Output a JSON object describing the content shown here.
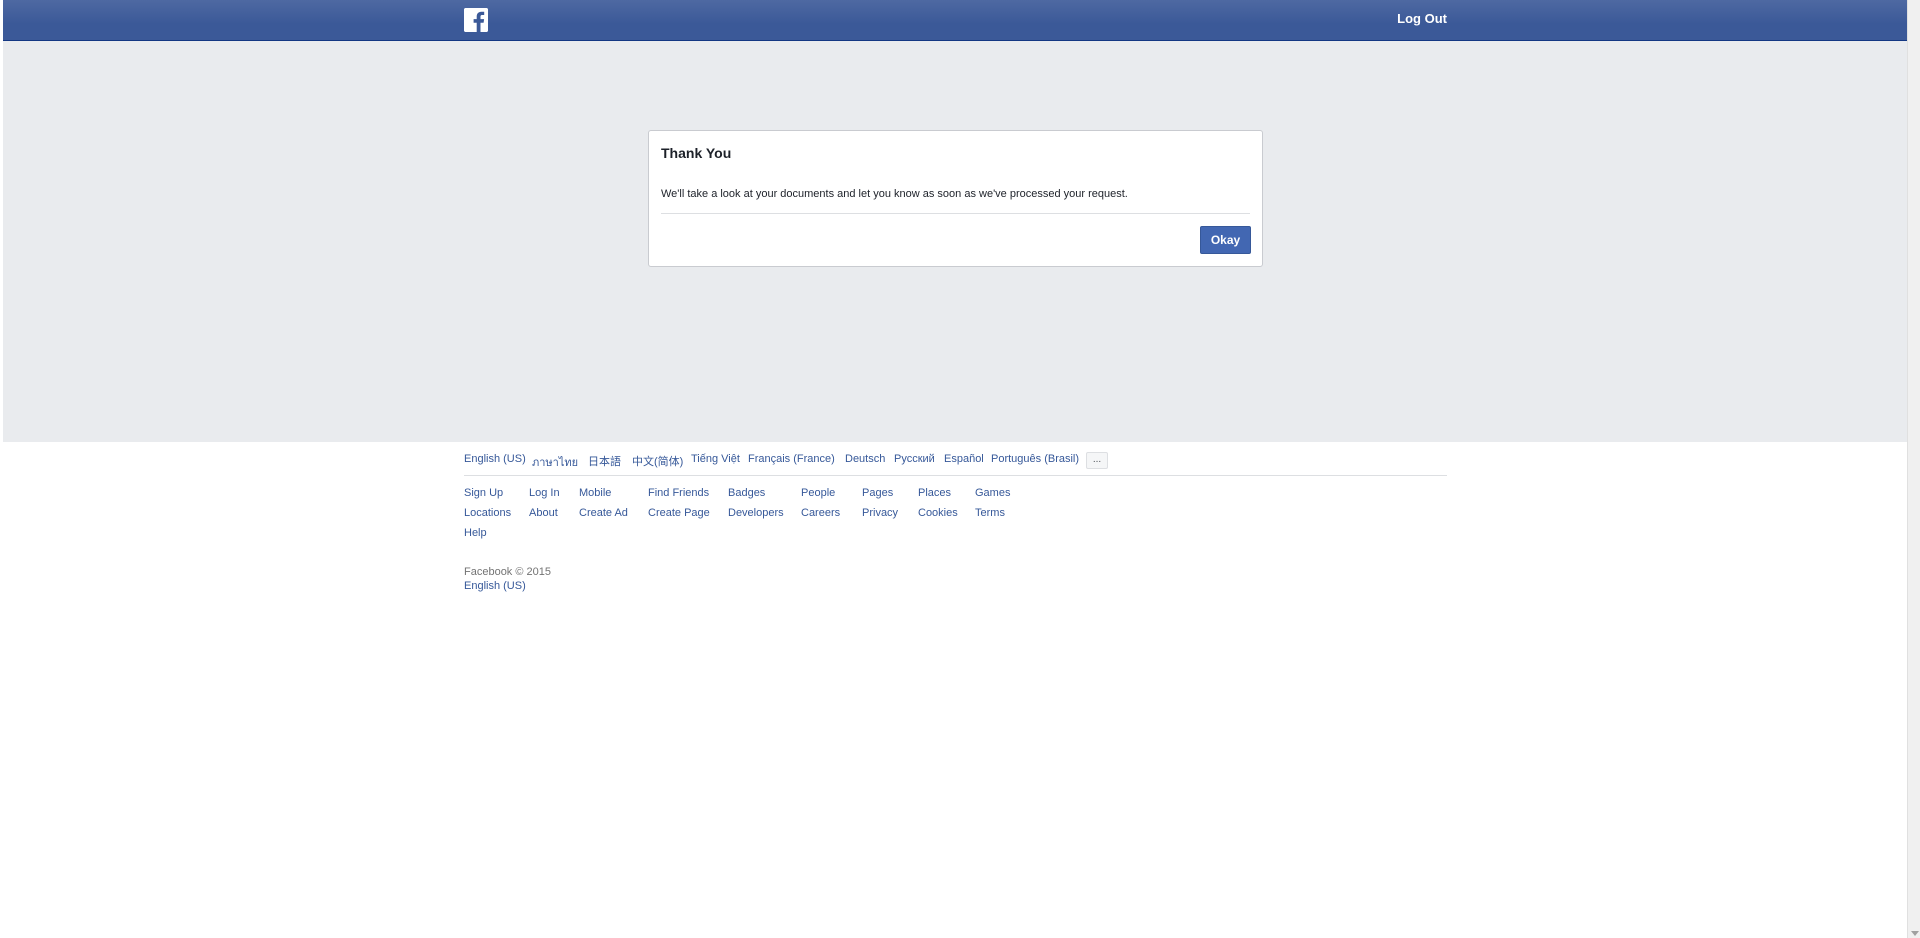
{
  "header": {
    "logout_label": "Log Out"
  },
  "dialog": {
    "title": "Thank You",
    "body": "We'll take a look at your documents and let you know as soon as we've processed your request.",
    "okay_label": "Okay"
  },
  "footer": {
    "languages": [
      "English (US)",
      "ภาษาไทย",
      "日本語",
      "中文(简体)",
      "Tiếng Việt",
      "Français (France)",
      "Deutsch",
      "Русский",
      "Español",
      "Português (Brasil)"
    ],
    "more_languages_label": "...",
    "links": [
      "Sign Up",
      "Log In",
      "Mobile",
      "Find Friends",
      "Badges",
      "People",
      "Pages",
      "Places",
      "Games",
      "Locations",
      "About",
      "Create Ad",
      "Create Page",
      "Developers",
      "Careers",
      "Privacy",
      "Cookies",
      "Terms",
      "Help"
    ],
    "copyright": "Facebook © 2015",
    "current_language": "English (US)"
  },
  "colors": {
    "brand_blue": "#3b5998",
    "link_blue": "#365899",
    "button_blue": "#4267b2",
    "background_grey": "#e9ebee"
  },
  "icons": {
    "logo": "facebook-f-icon",
    "scroll_down": "chevron-down-icon"
  }
}
